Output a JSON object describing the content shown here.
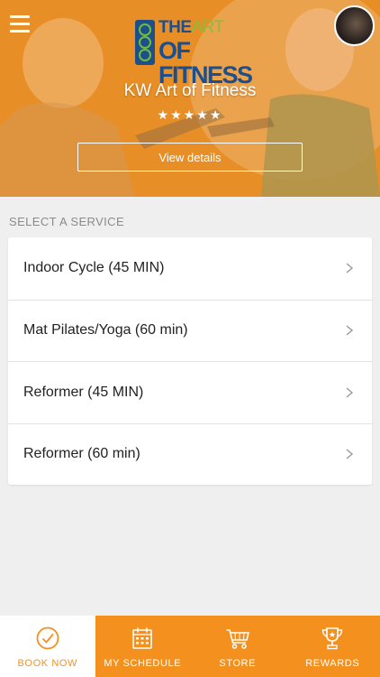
{
  "header": {
    "studio_name": "KW Art of Fitness",
    "rating_stars": "★★★★★",
    "view_details_label": "View details",
    "logo": {
      "line1_a": "THE",
      "line1_b": "ART",
      "line2": "OF FITNESS"
    }
  },
  "services": {
    "section_label": "SELECT A SERVICE",
    "items": [
      {
        "label": "Indoor Cycle (45 MIN)"
      },
      {
        "label": "Mat Pilates/Yoga (60 min)"
      },
      {
        "label": "Reformer (45 MIN)"
      },
      {
        "label": "Reformer (60 min)"
      }
    ]
  },
  "tabs": [
    {
      "label": "BOOK NOW",
      "icon": "checkmark-circle-icon",
      "active": true
    },
    {
      "label": "MY SCHEDULE",
      "icon": "calendar-icon",
      "active": false
    },
    {
      "label": "STORE",
      "icon": "shopping-cart-icon",
      "active": false
    },
    {
      "label": "REWARDS",
      "icon": "trophy-icon",
      "active": false
    }
  ],
  "colors": {
    "accent": "#f4911e",
    "logo_blue": "#1f4f8a",
    "logo_green": "#7cc242"
  }
}
